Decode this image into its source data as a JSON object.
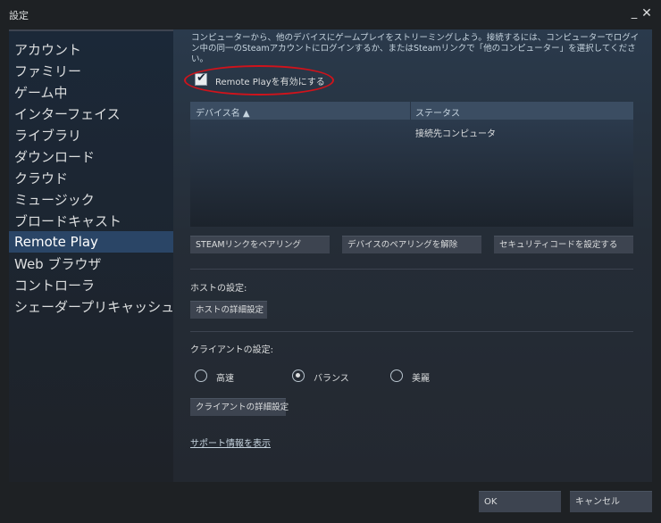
{
  "window": {
    "title": "設定",
    "minimize_glyph": "_",
    "close_glyph": "✕"
  },
  "sidebar": {
    "items": [
      {
        "label": "アカウント"
      },
      {
        "label": "ファミリー"
      },
      {
        "label": "ゲーム中"
      },
      {
        "label": "インターフェイス"
      },
      {
        "label": "ライブラリ"
      },
      {
        "label": "ダウンロード"
      },
      {
        "label": "クラウド"
      },
      {
        "label": "ミュージック"
      },
      {
        "label": "ブロードキャスト"
      },
      {
        "label": "Remote Play",
        "active": true
      },
      {
        "label": "Web ブラウザ"
      },
      {
        "label": "コントローラ"
      },
      {
        "label": "シェーダープリキャッシュ"
      }
    ]
  },
  "main": {
    "description": "コンピューターから、他のデバイスにゲームプレイをストリーミングしよう。接続するには、コンピューターでログイン中の同一のSteamアカウントにログインするか、またはSteamリンクで「他のコンピューター」を選択してください。",
    "enable_remote_play": {
      "label": "Remote Playを有効にする",
      "checked": true
    },
    "device_table": {
      "columns": [
        "デバイス名 ▲",
        "ステータス"
      ],
      "rows": [
        {
          "device": "",
          "status": "接続先コンピュータ"
        }
      ]
    },
    "buttons": {
      "pair_steam_link": "STEAMリンクをペアリング",
      "unpair_devices": "デバイスのペアリングを解除",
      "set_security_code": "セキュリティコードを設定する"
    },
    "host": {
      "label": "ホストの設定:",
      "advanced_button": "ホストの詳細設定"
    },
    "client": {
      "label": "クライアントの設定:",
      "options": [
        {
          "label": "高速",
          "selected": false
        },
        {
          "label": "バランス",
          "selected": true
        },
        {
          "label": "美麗",
          "selected": false
        }
      ],
      "advanced_button": "クライアントの詳細設定"
    },
    "support_link": "サポート情報を表示"
  },
  "footer": {
    "ok": "OK",
    "cancel": "キャンセル"
  }
}
